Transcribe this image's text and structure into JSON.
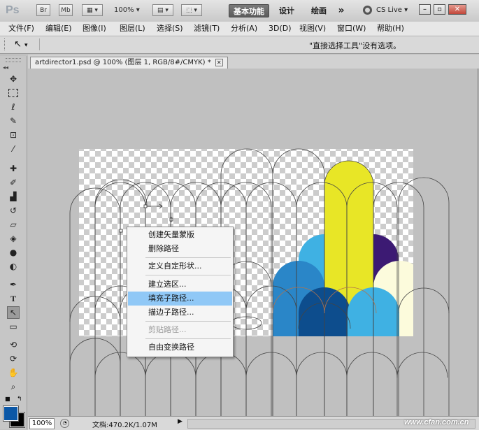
{
  "app_bar": {
    "logo": "Ps",
    "bridge": "Br",
    "minibridge": "Mb",
    "zoom": "100%",
    "workspaces": [
      "基本功能",
      "设计",
      "绘画"
    ],
    "more": "»",
    "cslive": "CS Live"
  },
  "menu": [
    "文件(F)",
    "编辑(E)",
    "图像(I)",
    "图层(L)",
    "选择(S)",
    "滤镜(T)",
    "分析(A)",
    "3D(D)",
    "视图(V)",
    "窗口(W)",
    "帮助(H)"
  ],
  "options": {
    "message": "\"直接选择工具\"没有选项。"
  },
  "document": {
    "tab_title": "artdirector1.psd @ 100% (图层 1, RGB/8#/CMYK) *"
  },
  "context_menu": {
    "items": [
      "创建矢量蒙版",
      "删除路径",
      "定义自定形状...",
      "建立选区...",
      "填充子路径...",
      "描边子路径...",
      "剪贴路径...",
      "自由变换路径"
    ]
  },
  "status": {
    "zoom": "100%",
    "doc_size": "文档:470.2K/1.07M"
  },
  "watermark": "www.cfan.com.cn",
  "colors": {
    "foreground": "#0b57a6",
    "background": "#000000",
    "yellow": "#e8e626",
    "light_blue": "#3fb1e3",
    "mid_blue": "#2a86c8",
    "dark_blue": "#0d4d8d",
    "purple": "#3c1a73",
    "cream": "#fcfbdc"
  }
}
